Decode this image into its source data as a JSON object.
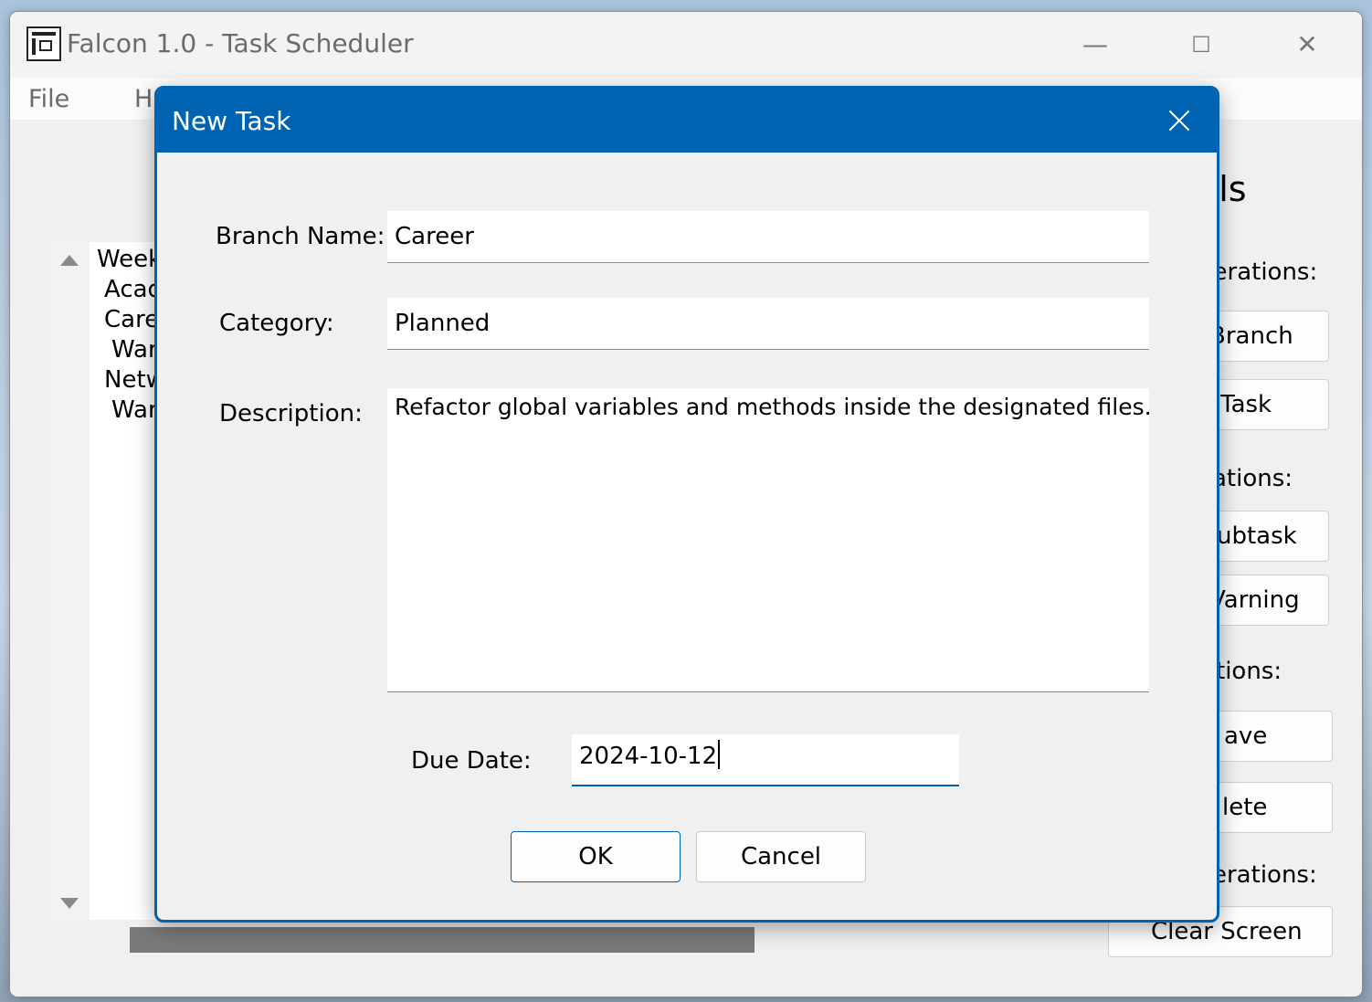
{
  "window": {
    "title": "Falcon 1.0 - Task Scheduler",
    "minimize": "—",
    "maximize": "☐",
    "close": "✕"
  },
  "menu": {
    "items": [
      "File",
      "H"
    ]
  },
  "tree": {
    "items": [
      "Week",
      "Acad",
      "Care",
      "War",
      "Netw",
      "War"
    ]
  },
  "tools": {
    "heading": "ols",
    "sections": [
      {
        "label": "perations:",
        "buttons": [
          "Branch",
          "Task"
        ]
      },
      {
        "label": "ations:",
        "buttons": [
          "ubtask",
          "Varning"
        ]
      },
      {
        "label": "tions:",
        "buttons": [
          "ave",
          "lete"
        ]
      },
      {
        "label": "erations:",
        "buttons": [
          "Clear Screen"
        ]
      }
    ]
  },
  "dialog": {
    "title": "New Task",
    "branch_label": "Branch Name:",
    "branch_value": "Career",
    "category_label": "Category:",
    "category_value": "Planned",
    "description_label": "Description:",
    "description_value": "Refactor global variables and methods inside the designated files.",
    "due_date_label": "Due Date:",
    "due_date_value": "2024-10-12",
    "ok_label": "OK",
    "cancel_label": "Cancel"
  },
  "colors": {
    "accent": "#0063b1",
    "window_bg": "#f0f0f0"
  }
}
